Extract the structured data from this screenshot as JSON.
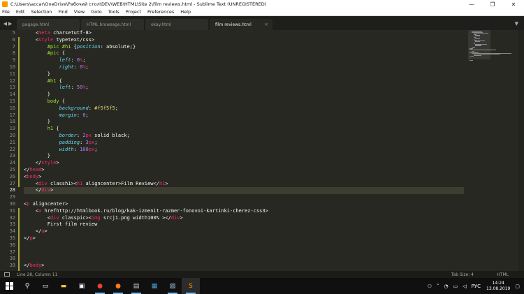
{
  "window": {
    "title": "C:\\Users\\accar\\OneDrive\\Рабочий стол\\DEV\\WEB\\HTML\\Site 2\\film reviews.html - Sublime Text (UNREGISTERED)",
    "minimize_glyph": "—",
    "maximize_glyph": "❐",
    "close_glyph": "✕"
  },
  "menu": [
    "File",
    "Edit",
    "Selection",
    "Find",
    "View",
    "Goto",
    "Tools",
    "Project",
    "Preferences",
    "Help"
  ],
  "tabs": [
    {
      "label": "pagage.html",
      "active": false
    },
    {
      "label": "HTML browsage.html",
      "active": false
    },
    {
      "label": "okay.html",
      "active": false
    },
    {
      "label": "film reviews.html",
      "active": true
    }
  ],
  "tab_close_glyph": "×",
  "editor": {
    "current_line": 28,
    "lines": [
      {
        "n": 5,
        "text": "    <meta charset=\"utf-8\">"
      },
      {
        "n": 6,
        "text": "    <style type=\"text/css\">"
      },
      {
        "n": 7,
        "text": "        #pic #h1 {position: absolute;}"
      },
      {
        "n": 8,
        "text": "        #pic {"
      },
      {
        "n": 9,
        "text": "            left: 0%;"
      },
      {
        "n": 10,
        "text": "            right: 0%;"
      },
      {
        "n": 11,
        "text": "        }"
      },
      {
        "n": 12,
        "text": "        #h1 {"
      },
      {
        "n": 13,
        "text": "            left: 50%;"
      },
      {
        "n": 14,
        "text": "        }"
      },
      {
        "n": 15,
        "text": "        body {"
      },
      {
        "n": 16,
        "text": "            background: #f5f5f5;"
      },
      {
        "n": 17,
        "text": "            margin: 0;"
      },
      {
        "n": 18,
        "text": "        }"
      },
      {
        "n": 19,
        "text": "        h1 {"
      },
      {
        "n": 20,
        "text": "            border: 2px solid black;"
      },
      {
        "n": 21,
        "text": "            padding: 3px;"
      },
      {
        "n": 22,
        "text": "            width: 100px;"
      },
      {
        "n": 23,
        "text": "        }"
      },
      {
        "n": 24,
        "text": "    </style>"
      },
      {
        "n": 25,
        "text": "</head>"
      },
      {
        "n": 26,
        "text": "<body>"
      },
      {
        "n": 27,
        "text": "    <div class=\"h1\"><h1 align=\"center\">Film Review</h1>"
      },
      {
        "n": 28,
        "text": "    </div>"
      },
      {
        "n": 29,
        "text": ""
      },
      {
        "n": 30,
        "text": "<p align=\"center\">"
      },
      {
        "n": 31,
        "text": "    <a href=\"http://htmlbook.ru/blog/kak-izmenit-razmer-fonovoi-kartinki-cherez-css3\">"
      },
      {
        "n": 32,
        "text": "        <div class=\"pic\"><img src=\"j1.png\" width=\"100%\" ></div>"
      },
      {
        "n": 33,
        "text": "        First film review"
      },
      {
        "n": 34,
        "text": "    </a>"
      },
      {
        "n": 35,
        "text": "</p>"
      },
      {
        "n": 36,
        "text": ""
      },
      {
        "n": 37,
        "text": ""
      },
      {
        "n": 38,
        "text": ""
      },
      {
        "n": 39,
        "text": "</body>"
      }
    ]
  },
  "status": {
    "position": "Line 28, Column 11",
    "tab_size": "Tab Size: 4",
    "syntax": "HTML"
  },
  "taskbar": {
    "apps": [
      "start-icon",
      "search-icon",
      "task-view-icon",
      "file-explorer-icon",
      "store-icon",
      "chrome-icon",
      "firefox-icon",
      "terminal-icon",
      "photos-icon",
      "media-icon",
      "sublime-text-icon"
    ],
    "tray_lang": "РУС",
    "time": "14:24",
    "date": "13.08.2019"
  },
  "colors": {
    "tag": "#f92672",
    "attr": "#a6e22e",
    "string": "#e6db74",
    "number": "#ae81ff",
    "property": "#66d9ef",
    "text": "#f8f8f2",
    "background": "#272822"
  }
}
